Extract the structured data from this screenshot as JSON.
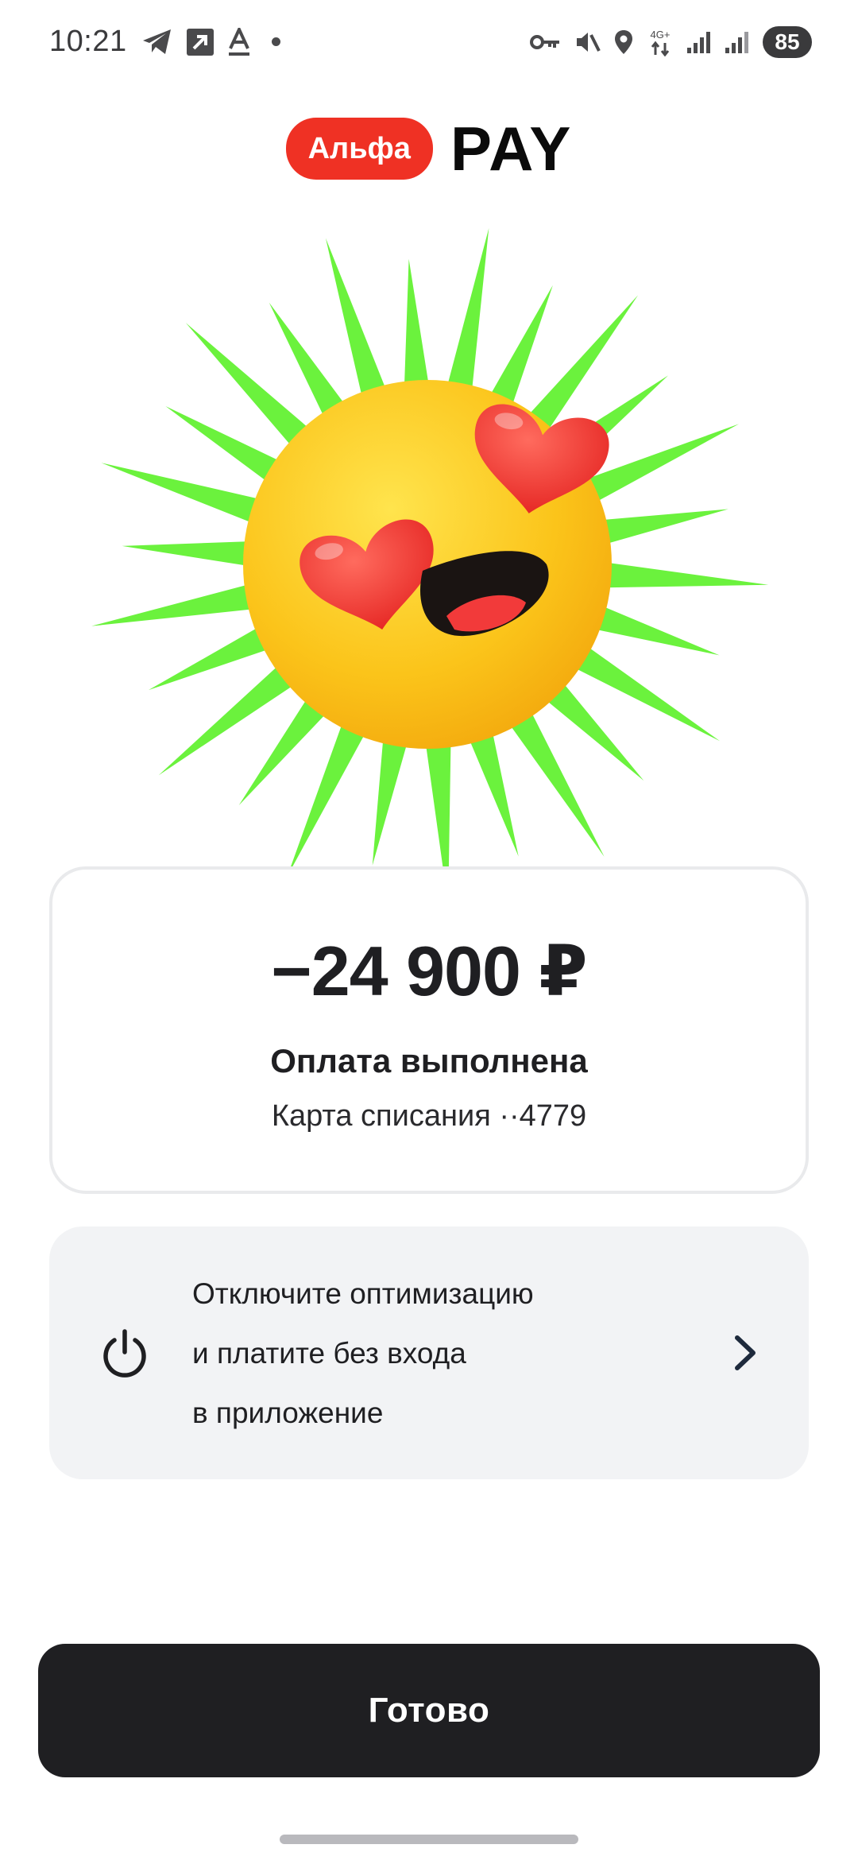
{
  "status_bar": {
    "time": "10:21",
    "network": "4G+",
    "battery": "85"
  },
  "logo": {
    "badge_text": "Альфа",
    "pay_text": "PAY",
    "brand_color": "#ef3124"
  },
  "payment": {
    "amount": "−24 900 ₽",
    "status": "Оплата выполнена",
    "card_info": "Карта списания ··4779"
  },
  "promo": {
    "icon": "power-icon",
    "line1": "Отключите оптимизацию",
    "line2": "и платите без входа",
    "line3": "в приложение"
  },
  "done_button": {
    "label": "Готово"
  },
  "colors": {
    "sun": "#fbc41a",
    "rays": "#6bf23d",
    "hearts": "#f2302b",
    "button": "#1f1f22"
  }
}
